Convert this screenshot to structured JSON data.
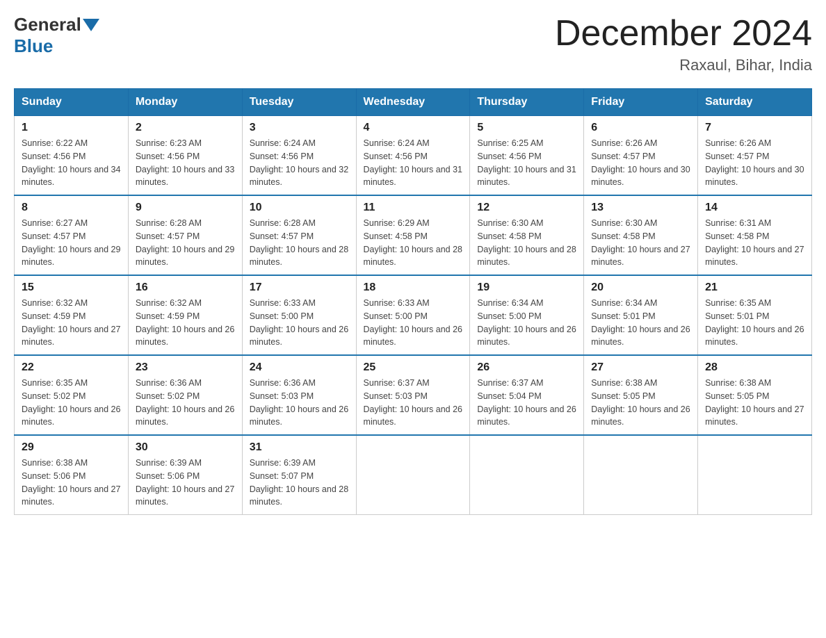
{
  "header": {
    "logo_general": "General",
    "logo_blue": "Blue",
    "month_title": "December 2024",
    "location": "Raxaul, Bihar, India"
  },
  "days_of_week": [
    "Sunday",
    "Monday",
    "Tuesday",
    "Wednesday",
    "Thursday",
    "Friday",
    "Saturday"
  ],
  "weeks": [
    [
      {
        "day": "1",
        "sunrise": "6:22 AM",
        "sunset": "4:56 PM",
        "daylight": "10 hours and 34 minutes."
      },
      {
        "day": "2",
        "sunrise": "6:23 AM",
        "sunset": "4:56 PM",
        "daylight": "10 hours and 33 minutes."
      },
      {
        "day": "3",
        "sunrise": "6:24 AM",
        "sunset": "4:56 PM",
        "daylight": "10 hours and 32 minutes."
      },
      {
        "day": "4",
        "sunrise": "6:24 AM",
        "sunset": "4:56 PM",
        "daylight": "10 hours and 31 minutes."
      },
      {
        "day": "5",
        "sunrise": "6:25 AM",
        "sunset": "4:56 PM",
        "daylight": "10 hours and 31 minutes."
      },
      {
        "day": "6",
        "sunrise": "6:26 AM",
        "sunset": "4:57 PM",
        "daylight": "10 hours and 30 minutes."
      },
      {
        "day": "7",
        "sunrise": "6:26 AM",
        "sunset": "4:57 PM",
        "daylight": "10 hours and 30 minutes."
      }
    ],
    [
      {
        "day": "8",
        "sunrise": "6:27 AM",
        "sunset": "4:57 PM",
        "daylight": "10 hours and 29 minutes."
      },
      {
        "day": "9",
        "sunrise": "6:28 AM",
        "sunset": "4:57 PM",
        "daylight": "10 hours and 29 minutes."
      },
      {
        "day": "10",
        "sunrise": "6:28 AM",
        "sunset": "4:57 PM",
        "daylight": "10 hours and 28 minutes."
      },
      {
        "day": "11",
        "sunrise": "6:29 AM",
        "sunset": "4:58 PM",
        "daylight": "10 hours and 28 minutes."
      },
      {
        "day": "12",
        "sunrise": "6:30 AM",
        "sunset": "4:58 PM",
        "daylight": "10 hours and 28 minutes."
      },
      {
        "day": "13",
        "sunrise": "6:30 AM",
        "sunset": "4:58 PM",
        "daylight": "10 hours and 27 minutes."
      },
      {
        "day": "14",
        "sunrise": "6:31 AM",
        "sunset": "4:58 PM",
        "daylight": "10 hours and 27 minutes."
      }
    ],
    [
      {
        "day": "15",
        "sunrise": "6:32 AM",
        "sunset": "4:59 PM",
        "daylight": "10 hours and 27 minutes."
      },
      {
        "day": "16",
        "sunrise": "6:32 AM",
        "sunset": "4:59 PM",
        "daylight": "10 hours and 26 minutes."
      },
      {
        "day": "17",
        "sunrise": "6:33 AM",
        "sunset": "5:00 PM",
        "daylight": "10 hours and 26 minutes."
      },
      {
        "day": "18",
        "sunrise": "6:33 AM",
        "sunset": "5:00 PM",
        "daylight": "10 hours and 26 minutes."
      },
      {
        "day": "19",
        "sunrise": "6:34 AM",
        "sunset": "5:00 PM",
        "daylight": "10 hours and 26 minutes."
      },
      {
        "day": "20",
        "sunrise": "6:34 AM",
        "sunset": "5:01 PM",
        "daylight": "10 hours and 26 minutes."
      },
      {
        "day": "21",
        "sunrise": "6:35 AM",
        "sunset": "5:01 PM",
        "daylight": "10 hours and 26 minutes."
      }
    ],
    [
      {
        "day": "22",
        "sunrise": "6:35 AM",
        "sunset": "5:02 PM",
        "daylight": "10 hours and 26 minutes."
      },
      {
        "day": "23",
        "sunrise": "6:36 AM",
        "sunset": "5:02 PM",
        "daylight": "10 hours and 26 minutes."
      },
      {
        "day": "24",
        "sunrise": "6:36 AM",
        "sunset": "5:03 PM",
        "daylight": "10 hours and 26 minutes."
      },
      {
        "day": "25",
        "sunrise": "6:37 AM",
        "sunset": "5:03 PM",
        "daylight": "10 hours and 26 minutes."
      },
      {
        "day": "26",
        "sunrise": "6:37 AM",
        "sunset": "5:04 PM",
        "daylight": "10 hours and 26 minutes."
      },
      {
        "day": "27",
        "sunrise": "6:38 AM",
        "sunset": "5:05 PM",
        "daylight": "10 hours and 26 minutes."
      },
      {
        "day": "28",
        "sunrise": "6:38 AM",
        "sunset": "5:05 PM",
        "daylight": "10 hours and 27 minutes."
      }
    ],
    [
      {
        "day": "29",
        "sunrise": "6:38 AM",
        "sunset": "5:06 PM",
        "daylight": "10 hours and 27 minutes."
      },
      {
        "day": "30",
        "sunrise": "6:39 AM",
        "sunset": "5:06 PM",
        "daylight": "10 hours and 27 minutes."
      },
      {
        "day": "31",
        "sunrise": "6:39 AM",
        "sunset": "5:07 PM",
        "daylight": "10 hours and 28 minutes."
      },
      null,
      null,
      null,
      null
    ]
  ],
  "labels": {
    "sunrise": "Sunrise:",
    "sunset": "Sunset:",
    "daylight": "Daylight:"
  }
}
